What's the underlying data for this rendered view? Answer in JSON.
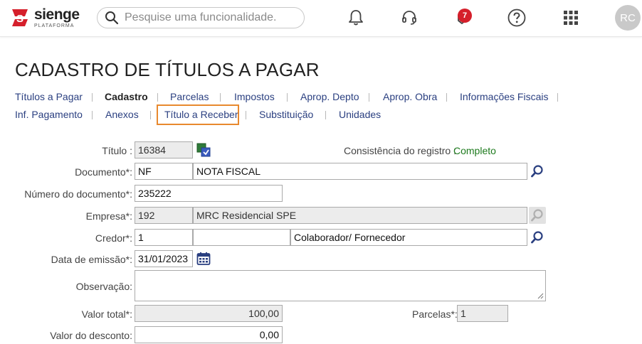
{
  "header": {
    "brand": "sienge",
    "brand_sub": "PLATAFORMA",
    "search_placeholder": "Pesquise uma funcionalidade.",
    "notifications_badge": "7",
    "avatar_initials": "RC"
  },
  "page": {
    "title": "CADASTRO DE TÍTULOS A PAGAR"
  },
  "tabs": [
    {
      "label": "Títulos a Pagar",
      "active": false
    },
    {
      "label": "Cadastro",
      "active": true
    },
    {
      "label": "Parcelas",
      "active": false
    },
    {
      "label": "Impostos",
      "active": false
    },
    {
      "label": "Aprop. Depto",
      "active": false
    },
    {
      "label": "Aprop. Obra",
      "active": false
    },
    {
      "label": "Informações Fiscais",
      "active": false
    },
    {
      "label": "Inf. Pagamento",
      "active": false
    },
    {
      "label": "Anexos",
      "active": false
    },
    {
      "label": "Título a Receber",
      "active": false,
      "highlighted": true
    },
    {
      "label": "Substituição",
      "active": false
    },
    {
      "label": "Unidades",
      "active": false
    }
  ],
  "form": {
    "titulo": {
      "label": "Título :",
      "value": "16384"
    },
    "consistencia": {
      "label": "Consistência do registro :",
      "value": "Completo"
    },
    "documento": {
      "label": "Documento*:",
      "code": "NF",
      "description": "NOTA FISCAL"
    },
    "numero_documento": {
      "label": "Número do documento*:",
      "value": "235222"
    },
    "empresa": {
      "label": "Empresa*:",
      "code": "192",
      "name": "MRC Residencial SPE"
    },
    "credor": {
      "label": "Credor*:",
      "code": "1",
      "document": "",
      "name": "Colaborador/ Fornecedor"
    },
    "data_emissao": {
      "label": "Data de emissão*:",
      "value": "31/01/2023"
    },
    "observacao": {
      "label": "Observação:",
      "value": ""
    },
    "valor_total": {
      "label": "Valor total*:",
      "value": "100,00"
    },
    "parcelas": {
      "label": "Parcelas*:",
      "value": "1"
    },
    "valor_desconto": {
      "label": "Valor do desconto:",
      "value": "0,00"
    }
  },
  "colors": {
    "brand_red": "#d51f2b",
    "link_blue": "#2a3f80",
    "highlight_orange": "#e8892e",
    "status_green": "#1d7a1d"
  }
}
